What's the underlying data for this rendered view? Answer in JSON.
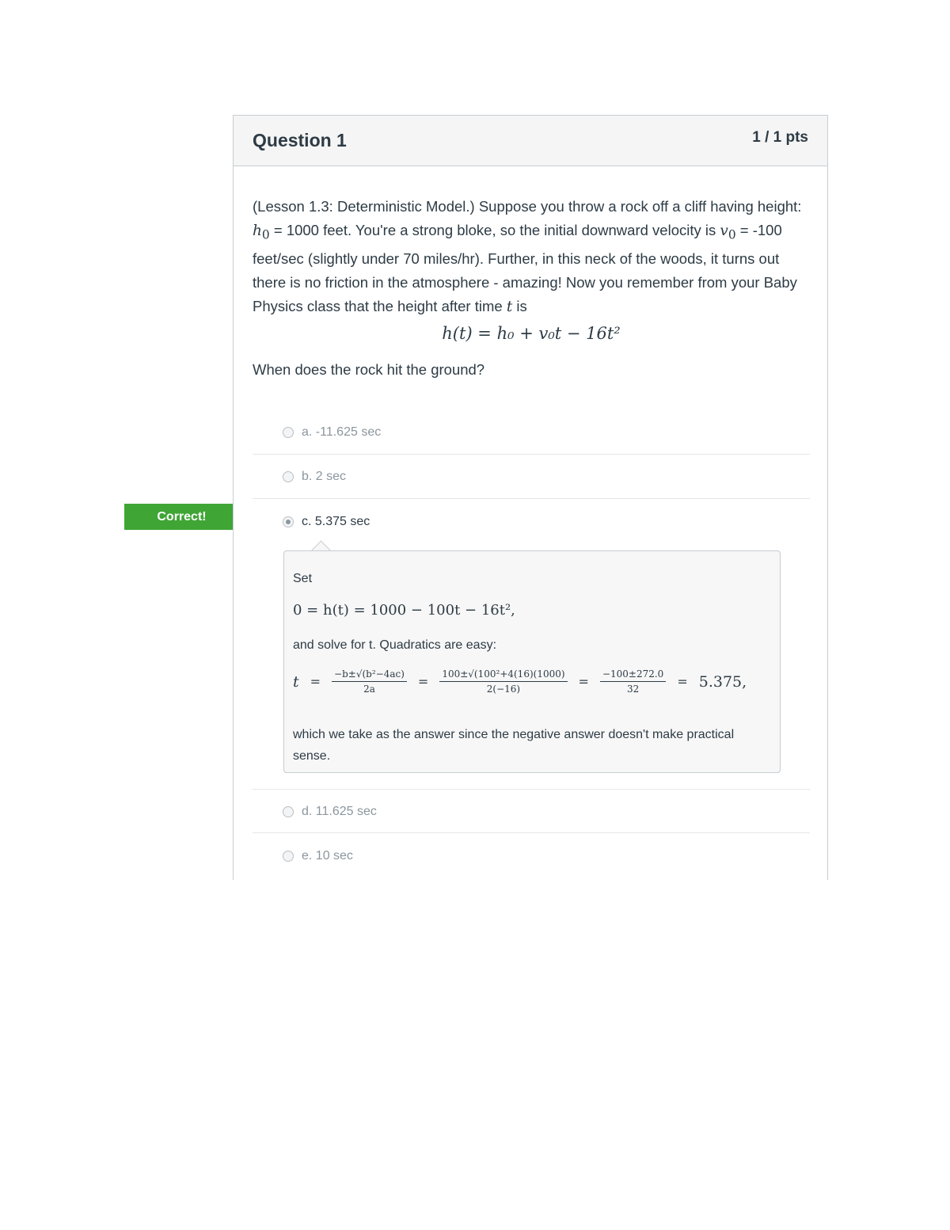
{
  "question": {
    "title": "Question 1",
    "points": "1 / 1 pts",
    "text_part1": "(Lesson 1.3: Deterministic Model.) Suppose you throw a rock off a cliff having height: ",
    "h0_symbol": "h",
    "h0_sub": "0",
    "text_part2": " = 1000 feet. You're a strong bloke, so the initial downward velocity is ",
    "v0_symbol": "v",
    "v0_sub": "0",
    "text_part3": " = -100 feet/sec (slightly under 70 miles/hr). Further, in this neck of the woods, it turns out there is no friction in the atmosphere - amazing! Now you remember from your Baby Physics class that the height after time ",
    "t_symbol": "t",
    "text_part4": " is",
    "formula": "h(t) = h₀ + v₀t − 16t²",
    "prompt": "When does the rock hit the ground?"
  },
  "answers": [
    {
      "label": "a. -11.625 sec"
    },
    {
      "label": "b. 2 sec"
    },
    {
      "label": "c. 5.375 sec"
    },
    {
      "label": "d. 11.625 sec"
    },
    {
      "label": "e. 10 sec"
    }
  ],
  "feedback": {
    "correct_label": "Correct!",
    "set_label": "Set",
    "eq1": "0  =  h(t)  =  1000 − 100t − 16t²,",
    "solve_text": "and solve for t.  Quadratics are easy:",
    "eq2_t": "t",
    "eq2_f1_num": "−b±√(b²−4ac)",
    "eq2_f1_den": "2a",
    "eq2_f2_num": "100±√(100²+4(16)(1000)",
    "eq2_f2_den": "2(−16)",
    "eq2_f3_num": "−100±272.0",
    "eq2_f3_den": "32",
    "eq2_result": "5.375,",
    "end_text": "which we take as the answer since the negative answer doesn't make practical sense."
  },
  "colors": {
    "correct_green": "#3fa535",
    "header_bg": "#f5f5f5",
    "border": "#c7cdd1"
  }
}
